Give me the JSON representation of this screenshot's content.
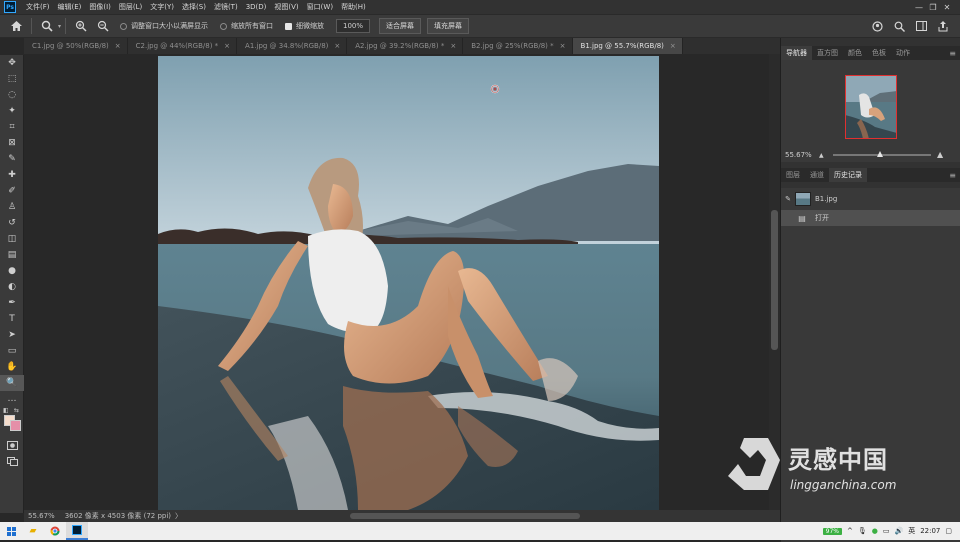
{
  "menubar": {
    "logo": "Ps",
    "items": [
      "文件(F)",
      "编辑(E)",
      "图像(I)",
      "图层(L)",
      "文字(Y)",
      "选择(S)",
      "滤镜(T)",
      "3D(D)",
      "视图(V)",
      "窗口(W)",
      "帮助(H)"
    ],
    "controls": [
      "—",
      "❐",
      "✕"
    ]
  },
  "options": {
    "chk_resize": "调整窗口大小以满屏显示",
    "chk_zoom_all": "缩放所有窗口",
    "chk_scrubby": "细微缩放",
    "zoom_value": "100%",
    "fit_screen": "适合屏幕",
    "fill_screen": "填充屏幕"
  },
  "tabs": [
    {
      "label": "C1.jpg @ 50%(RGB/8)",
      "active": false
    },
    {
      "label": "C2.jpg @ 44%(RGB/8) *",
      "active": false
    },
    {
      "label": "A1.jpg @ 34.8%(RGB/8)",
      "active": false
    },
    {
      "label": "A2.jpg @ 39.2%(RGB/8) *",
      "active": false
    },
    {
      "label": "B2.jpg @ 25%(RGB/8) *",
      "active": false
    },
    {
      "label": "B1.jpg @ 55.7%(RGB/8)",
      "active": true
    }
  ],
  "tools": [
    "move-icon",
    "marquee-icon",
    "lasso-icon",
    "magic-wand-icon",
    "crop-icon",
    "frame-icon",
    "eyedropper-icon",
    "healing-icon",
    "brush-icon",
    "stamp-icon",
    "history-brush-icon",
    "eraser-icon",
    "gradient-icon",
    "blur-icon",
    "dodge-icon",
    "pen-icon",
    "type-icon",
    "path-select-icon",
    "shape-icon",
    "hand-icon",
    "zoom-icon",
    "more-icon"
  ],
  "tool_glyphs": [
    "✥",
    "⬚",
    "◌",
    "✦",
    "⌗",
    "⊠",
    "✎",
    "✚",
    "✐",
    "♙",
    "↺",
    "◫",
    "▤",
    "●",
    "◐",
    "✒",
    "T",
    "➤",
    "▭",
    "✋",
    "🔍",
    "…"
  ],
  "colors": {
    "foreground": "#f4dccb",
    "background": "#e58fa8",
    "accent": "#31a8ff",
    "battery": "#3cb043"
  },
  "status": {
    "zoom": "55.67%",
    "info": "3602 像素 x 4503 像素 (72 ppi)",
    "arrow": "〉"
  },
  "navigator": {
    "tabs": [
      "导航器",
      "直方图",
      "颜色",
      "色板",
      "动作"
    ],
    "zoom": "55.67%"
  },
  "history": {
    "tabs": [
      "图层",
      "通道",
      "历史记录"
    ],
    "snapshot": "B1.jpg",
    "items": [
      "打开"
    ]
  },
  "watermark": {
    "brand": "灵感中国",
    "url": "lingganchina.com"
  },
  "taskbar": {
    "battery": "97%",
    "ime": "英",
    "time": "22:07"
  }
}
